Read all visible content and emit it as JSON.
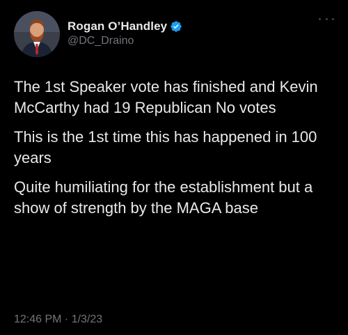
{
  "tweet": {
    "author": {
      "display_name": "Rogan O’Handley",
      "handle": "@DC_Draino",
      "verified_icon": "verified-badge-icon",
      "avatar_icon": "avatar-photo"
    },
    "more_icon": "more-options-icon",
    "paragraphs": [
      "The 1st Speaker vote has finished and Kevin McCarthy had 19 Republican No votes",
      "This is the 1st time this has happened in 100 years",
      "Quite humiliating for the establishment but a show of strength by the MAGA base"
    ],
    "timestamp": "12:46 PM · 1/3/23"
  },
  "colors": {
    "background": "#000000",
    "text": "#e7e9ea",
    "secondary_text": "#71767b",
    "verified": "#1d9bf0"
  }
}
